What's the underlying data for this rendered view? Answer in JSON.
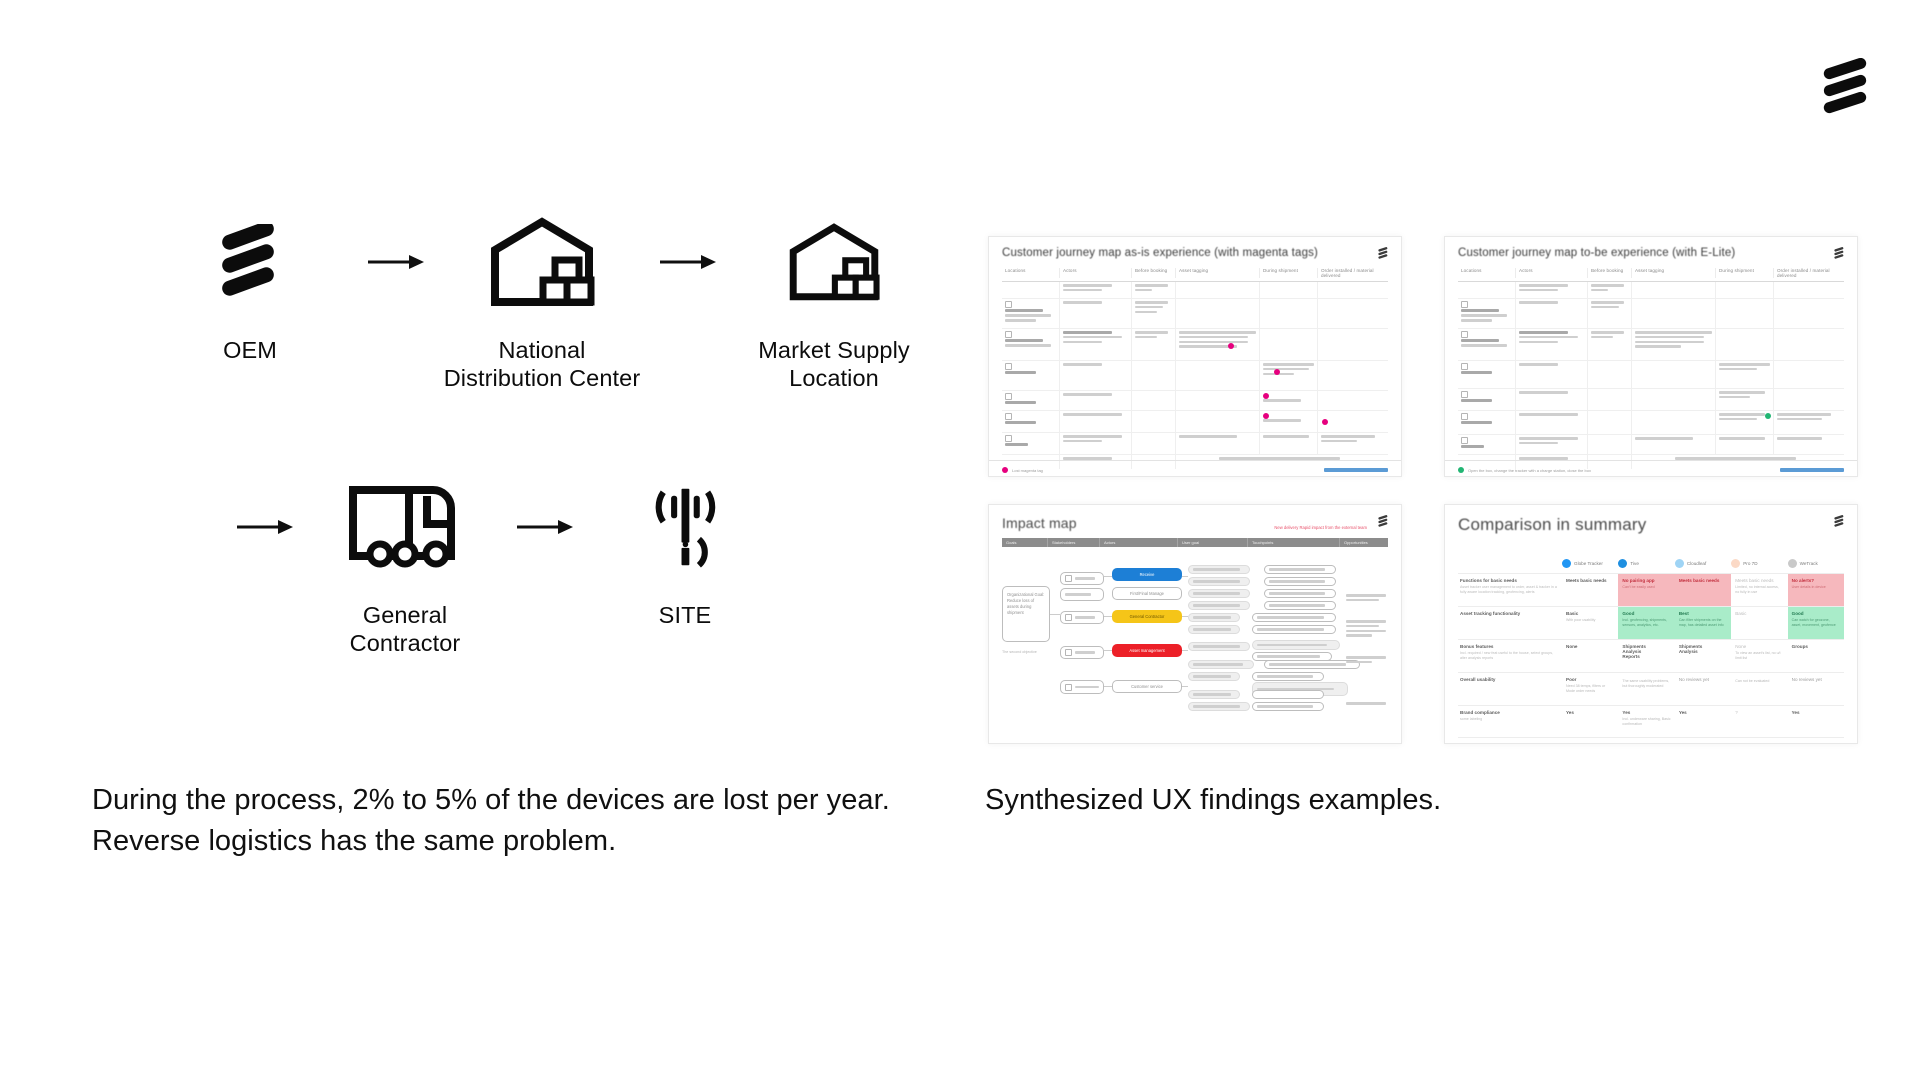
{
  "brand": {
    "logo_icon": "ericsson-logo-icon",
    "name": "Ericsson"
  },
  "flow": {
    "row1": [
      {
        "id": "oem",
        "icon": "ericsson-logo-icon",
        "label": "OEM"
      },
      {
        "id": "arrow-1",
        "icon": "arrow-right-icon",
        "label": ""
      },
      {
        "id": "national-distribution-center",
        "icon": "warehouse-icon",
        "label": "National\nDistribution Center"
      },
      {
        "id": "arrow-2",
        "icon": "arrow-right-icon",
        "label": ""
      },
      {
        "id": "market-supply-location",
        "icon": "warehouse-icon",
        "label": "Market Supply\nLocation"
      }
    ],
    "row2": [
      {
        "id": "arrow-3",
        "icon": "arrow-right-icon",
        "label": ""
      },
      {
        "id": "general-contractor",
        "icon": "truck-icon",
        "label": "General\nContractor"
      },
      {
        "id": "arrow-4",
        "icon": "arrow-right-icon",
        "label": ""
      },
      {
        "id": "site",
        "icon": "antenna-tower-icon",
        "label": "SITE"
      }
    ]
  },
  "captions": {
    "left": "During the process, 2% to 5% of the devices are lost per year.\nReverse logistics has the same problem.",
    "right": "Synthesized UX findings examples."
  },
  "thumbnails": [
    {
      "id": "journey-map-as-is",
      "title": "Customer journey map as-is experience (with magenta tags)",
      "type": "journey-map",
      "marker_color": "#e6007e",
      "legend": "Lost magenta tag",
      "columns": [
        "Locations",
        "Actors",
        "Before booking",
        "Asset tagging",
        "During shipment",
        "Order installed / material delivered"
      ]
    },
    {
      "id": "journey-map-to-be",
      "title": "Customer journey map to-be experience (with E-Lite)",
      "type": "journey-map",
      "marker_color": "#22b573",
      "legend": "Open the box, change the tracker with a charge station, close the box",
      "columns": [
        "Locations",
        "Actors",
        "Before booking",
        "Asset tagging",
        "During shipment",
        "Order installed / material delivered"
      ]
    },
    {
      "id": "impact-map",
      "title": "Impact map",
      "type": "impact-map",
      "note": "New delivery\nRapid impact from the external team",
      "columns": [
        "Goals",
        "Stakeholders",
        "Actors",
        "User goal",
        "Touchpoints",
        "Opportunities"
      ],
      "goal": "Organizational Goal:\nReduce loss of assets during shipment",
      "goal_note": "The second objective",
      "nodes": [
        {
          "label": "Receive",
          "color": "#1d7fd6"
        },
        {
          "label": "First/Final Manage",
          "color": "#ffffff"
        },
        {
          "label": "General Contractor",
          "color": "#f5c518"
        },
        {
          "label": "Asset management",
          "color": "#ec2028"
        },
        {
          "label": "Customer service",
          "color": "#ffffff"
        }
      ]
    },
    {
      "id": "comparison-summary",
      "title": "Comparison in summary",
      "type": "comparison-table",
      "products": [
        "Globe Tracker",
        "Tive",
        "Cloudleaf",
        "Pro 7D",
        "WeTrack"
      ],
      "rows": [
        {
          "label": "Functions for basic needs",
          "sublabel": "Asset tracker user management to order, asset & tracker in a fully aware location tracking, geofencing, alerts",
          "cells": [
            {
              "value": "Meets basic needs",
              "note": "",
              "state": "neutral"
            },
            {
              "value": "No pairing app",
              "note": "Can't be easily used",
              "state": "negative"
            },
            {
              "value": "Meets basic needs",
              "note": "",
              "state": "negative"
            },
            {
              "value": "Meets basic needs",
              "note": "Limited, no internal access, no fully in use",
              "state": "plain"
            },
            {
              "value": "No alerts?",
              "note": "User details in device",
              "state": "negative"
            }
          ]
        },
        {
          "label": "Asset tracking functionality",
          "sublabel": "",
          "cells": [
            {
              "value": "Basic",
              "note": "With poor usability",
              "state": "neutral"
            },
            {
              "value": "Good",
              "note": "Incl. geofencing, shipments, sensors, analytics, etc.",
              "state": "positive"
            },
            {
              "value": "Best",
              "note": "Can filter shipments on the map, has detailed asset info",
              "state": "positive"
            },
            {
              "value": "Basic",
              "note": "",
              "state": "plain"
            },
            {
              "value": "Good",
              "note": "Can watch for geozone, asset, movement, geofence",
              "state": "positive"
            }
          ]
        },
        {
          "label": "Bonus features",
          "sublabel": "Incl. required / new feat useful to the house, select groups, alter analysis reports",
          "cells": [
            {
              "value": "None",
              "note": "",
              "state": "neutral"
            },
            {
              "value": "Shipments\nAnalysis\nReports",
              "note": "",
              "state": "neutral"
            },
            {
              "value": "Shipments\nAnalysis",
              "note": "",
              "state": "neutral"
            },
            {
              "value": "None",
              "note": "To view an asset's list, no u/i limit list",
              "state": "plain"
            },
            {
              "value": "Groups",
              "note": "",
              "state": "neutral"
            }
          ]
        },
        {
          "label": "Overall usability",
          "sublabel": "",
          "cells": [
            {
              "value": "Poor",
              "note": "Need 38 temps, filters or Mode order needs",
              "state": "neutral"
            },
            {
              "value": "",
              "note": "The same usability problems, but thoroughly moderated",
              "state": "neutral"
            },
            {
              "value": "No reviews yet",
              "note": "",
              "state": "neutral"
            },
            {
              "value": "",
              "note": "Can not be evaluated",
              "state": "plain"
            },
            {
              "value": "No reviews yet",
              "note": "",
              "state": "neutral"
            }
          ]
        },
        {
          "label": "Brand compliance",
          "sublabel": "some labeling",
          "cells": [
            {
              "value": "Yes",
              "note": "",
              "state": "neutral"
            },
            {
              "value": "Yes",
              "note": "Incl. underware sharing, Basic confirmation",
              "state": "neutral"
            },
            {
              "value": "Yes",
              "note": "",
              "state": "neutral"
            },
            {
              "value": "?",
              "note": "",
              "state": "plain"
            },
            {
              "value": "Yes",
              "note": "",
              "state": "neutral"
            }
          ]
        }
      ]
    }
  ],
  "colors": {
    "magenta": "#e6007e",
    "green": "#22b573",
    "blue": "#1d7fd6",
    "yellow": "#f5c518",
    "red": "#ec2028",
    "text": "#101010",
    "background": "#ffffff"
  }
}
